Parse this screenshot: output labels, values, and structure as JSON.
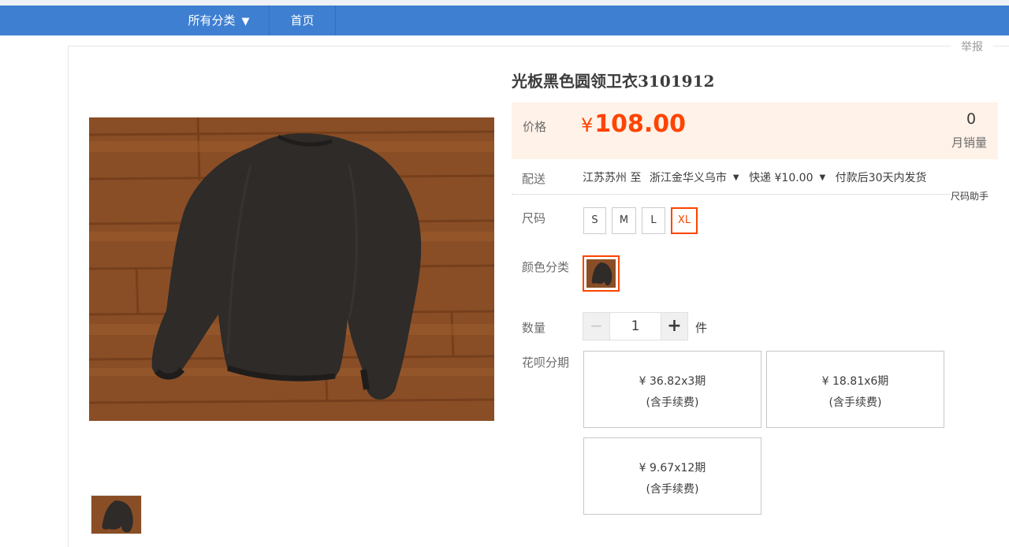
{
  "nav": {
    "all_categories": "所有分类",
    "home": "首页"
  },
  "report": "举报",
  "product": {
    "title": "光板黑色圆领卫衣3101912"
  },
  "price": {
    "label": "价格",
    "currency": "¥",
    "value": "108.00",
    "sales_count": "0",
    "sales_label": "月销量"
  },
  "delivery": {
    "label": "配送",
    "from": "江苏苏州 至",
    "to": "浙江金华义乌市",
    "express": "快递 ¥10.00",
    "ship_time": "付款后30天内发货",
    "size_helper": "尺码助手"
  },
  "size": {
    "label": "尺码",
    "options": [
      "S",
      "M",
      "L",
      "XL"
    ],
    "selected": "XL"
  },
  "color": {
    "label": "颜色分类"
  },
  "quantity": {
    "label": "数量",
    "minus": "−",
    "value": "1",
    "plus": "+",
    "unit": "件"
  },
  "installment": {
    "label": "花呗分期",
    "options": [
      {
        "amount": "¥ 36.82x3期",
        "note": "(含手续费)"
      },
      {
        "amount": "¥ 18.81x6期",
        "note": "(含手续费)"
      },
      {
        "amount": "¥ 9.67x12期",
        "note": "(含手续费)"
      }
    ]
  },
  "colors": {
    "accent": "#ff4400",
    "nav_bg": "#3e7fd1",
    "price_bg": "#fff2e8"
  }
}
